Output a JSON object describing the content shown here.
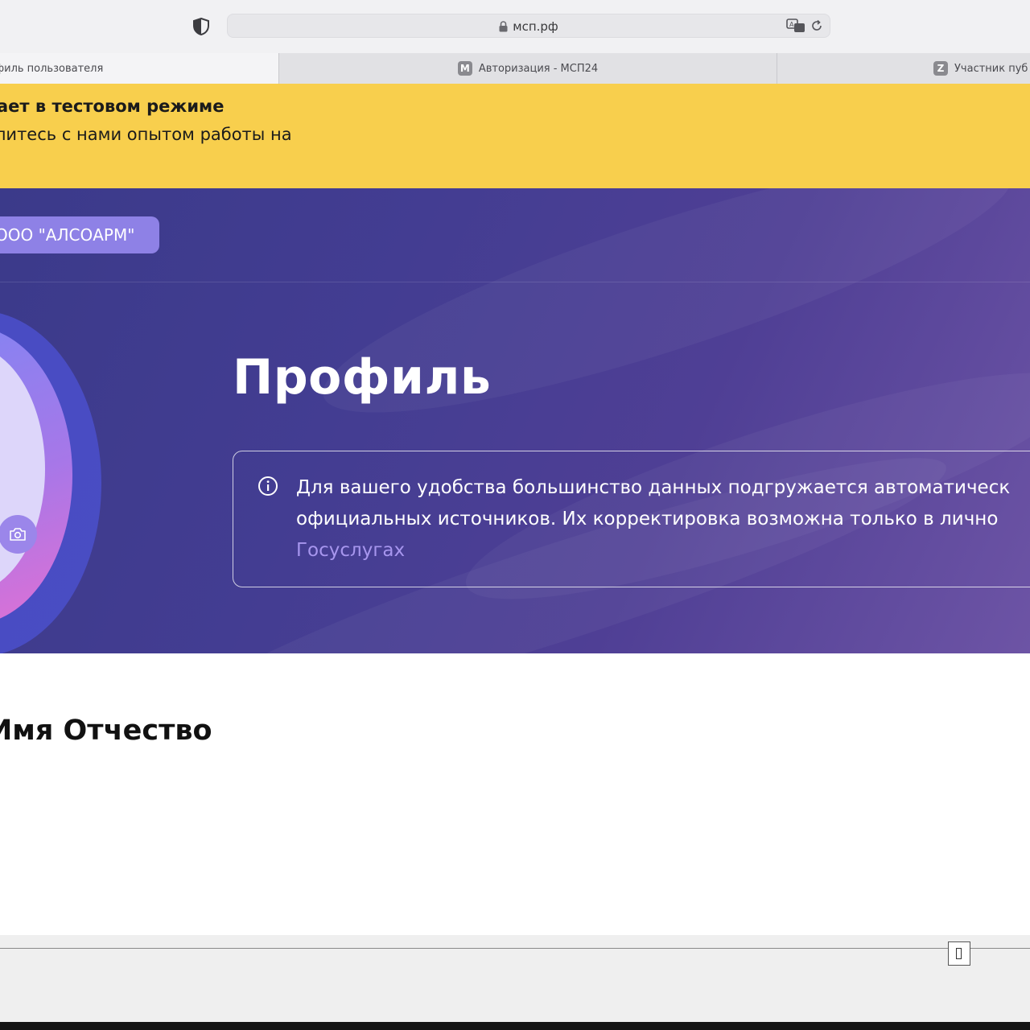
{
  "browser": {
    "url": "мсп.рф",
    "tabs": [
      {
        "label": "филь пользователя",
        "favicon": ""
      },
      {
        "label": "Авторизация - МСП24",
        "favicon": "M"
      },
      {
        "label": "Участник пуб",
        "favicon": "Z"
      }
    ]
  },
  "banner": {
    "title": "ает в тестовом режиме",
    "text": "литесь с нами опытом работы на"
  },
  "hero": {
    "org_chip": "ООО \"АЛСОАРМ\"",
    "title": "Профиль",
    "info": {
      "line1": "Для вашего удобства большинство данных подгружается автоматическ",
      "line2": "официальных источников. Их корректировка возможна только в лично",
      "link": "Госуслугах"
    }
  },
  "user": {
    "fullname": "Имя Отчество"
  },
  "colors": {
    "banner_bg": "#f8cf4d",
    "hero_bg": "#433d92",
    "org_chip_bg": "#8e81e6",
    "link": "#a796ee"
  },
  "icons": [
    "shield-icon",
    "lock-icon",
    "translate-icon",
    "reload-icon",
    "camera-icon",
    "info-icon"
  ]
}
